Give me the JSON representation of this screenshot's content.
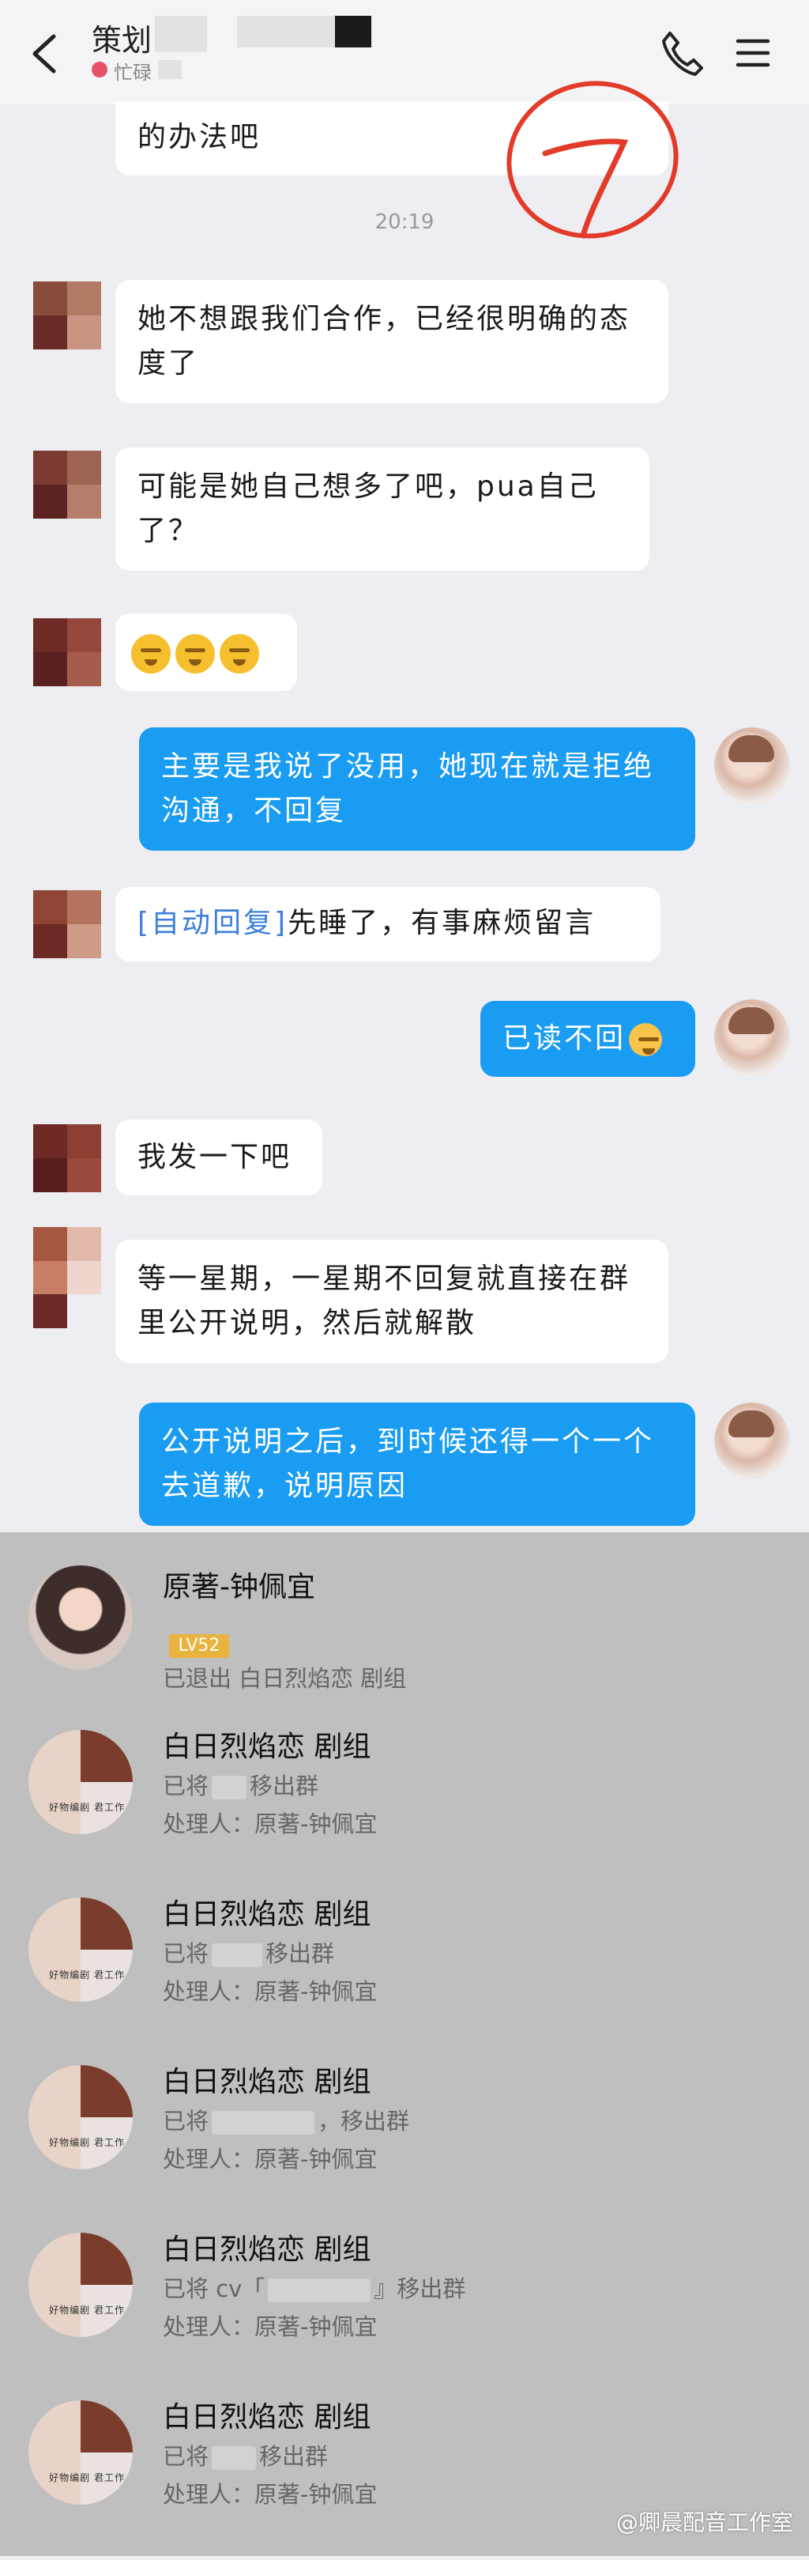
{
  "header": {
    "title": "策划",
    "status": "忙碌"
  },
  "chat": {
    "timestamp": "20:19",
    "messages": [
      {
        "id": "m0",
        "side": "left-cut",
        "text": "的办法吧"
      },
      {
        "id": "m1",
        "side": "left",
        "text": "她不想跟我们合作，已经很明确的态度了"
      },
      {
        "id": "m2",
        "side": "left",
        "text": "可能是她自己想多了吧，pua自己了？"
      },
      {
        "id": "m3",
        "side": "left",
        "emoji": [
          "hmph-face",
          "hmph-face",
          "hmph-face"
        ]
      },
      {
        "id": "m4",
        "side": "right",
        "text": "主要是我说了没用，她现在就是拒绝沟通，不回复"
      },
      {
        "id": "m5",
        "side": "left",
        "tag": "[自动回复]",
        "text": "先睡了，有事麻烦留言"
      },
      {
        "id": "m6",
        "side": "right",
        "text": "已读不回",
        "emoji": "smile-face"
      },
      {
        "id": "m7",
        "side": "left",
        "text": "我发一下吧"
      },
      {
        "id": "m8",
        "side": "left",
        "text": "等一星期，一星期不回复就直接在群里公开说明，然后就解散"
      },
      {
        "id": "m9",
        "side": "right",
        "text": "公开说明之后，到时候还得一个一个去道歉，说明原因"
      }
    ]
  },
  "notifications": [
    {
      "title": "原著-钟佩宜",
      "badge": "LV52",
      "line1": "已退出 白日烈焰恋 剧组"
    },
    {
      "title": "白日烈焰恋 剧组",
      "line1_prefix": "已将",
      "line1_suffix": "移出群",
      "line2": "处理人：原著-钟佩宜"
    },
    {
      "title": "白日烈焰恋 剧组",
      "line1_prefix": "已将",
      "line1_suffix": "移出群",
      "line2": "处理人：原著-钟佩宜"
    },
    {
      "title": "白日烈焰恋 剧组",
      "line1_prefix": "已将",
      "line1_suffix": "，移出群",
      "line2": "处理人：原著-钟佩宜"
    },
    {
      "title": "白日烈焰恋 剧组",
      "line1_prefix": "已将 cv「",
      "line1_suffix": "』移出群",
      "line2": "处理人：原著-钟佩宜"
    },
    {
      "title": "白日烈焰恋 剧组",
      "line1_prefix": "已将",
      "line1_suffix": "移出群",
      "line2": "处理人：原著-钟佩宜"
    }
  ],
  "studio_label": "好物编剧 君工作",
  "watermark": "@卿晨配音工作室",
  "colors": {
    "bubble_me": "#1a9cf2",
    "annotation": "#e23b2a"
  }
}
